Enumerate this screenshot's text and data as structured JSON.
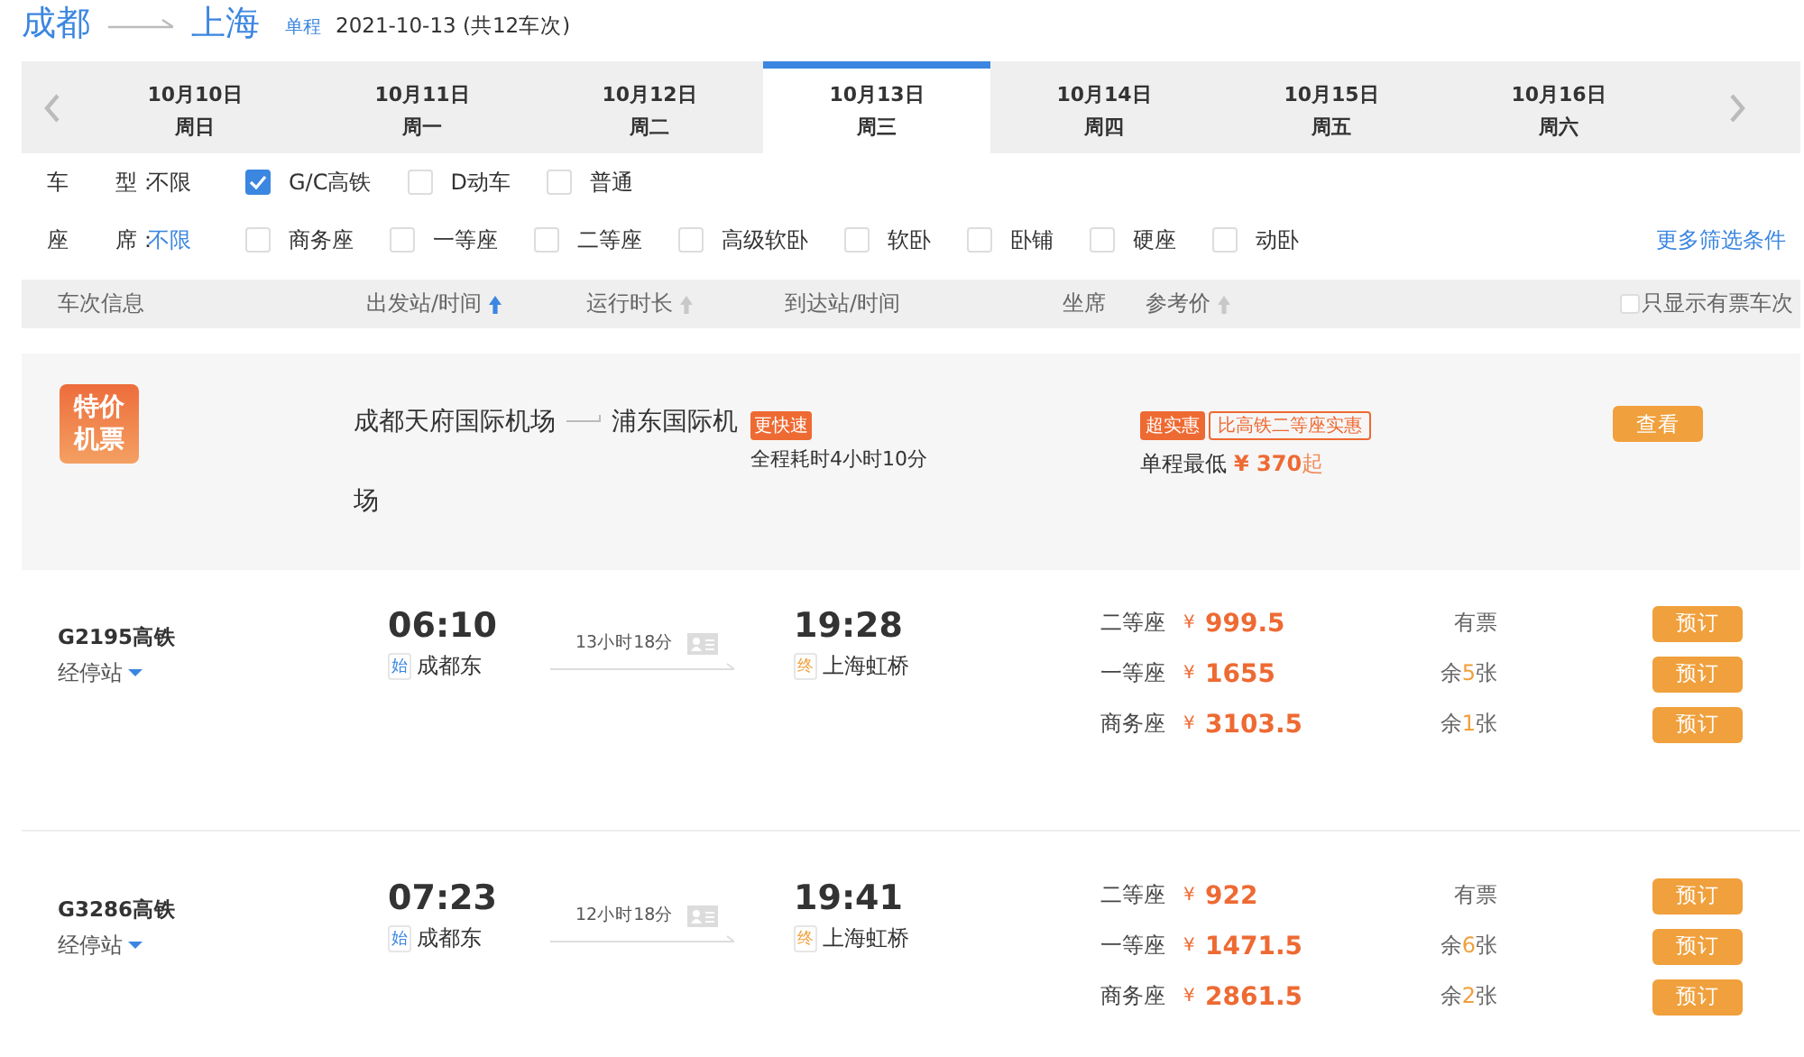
{
  "route": {
    "from": "成都",
    "to": "上海",
    "trip_type": "单程",
    "summary": "2021-10-13 (共12车次)"
  },
  "dates": [
    {
      "date": "10月10日",
      "weekday": "周日",
      "selected": false
    },
    {
      "date": "10月11日",
      "weekday": "周一",
      "selected": false
    },
    {
      "date": "10月12日",
      "weekday": "周二",
      "selected": false
    },
    {
      "date": "10月13日",
      "weekday": "周三",
      "selected": true
    },
    {
      "date": "10月14日",
      "weekday": "周四",
      "selected": false
    },
    {
      "date": "10月15日",
      "weekday": "周五",
      "selected": false
    },
    {
      "date": "10月16日",
      "weekday": "周六",
      "selected": false
    }
  ],
  "filters": [
    {
      "label": "车 型：",
      "any": "不限",
      "any_selected": false,
      "options": [
        {
          "label": "G/C高铁",
          "checked": true
        },
        {
          "label": "D动车",
          "checked": false
        },
        {
          "label": "普通",
          "checked": false
        }
      ]
    },
    {
      "label": "座 席：",
      "any": "不限",
      "any_selected": true,
      "options": [
        {
          "label": "商务座",
          "checked": false
        },
        {
          "label": "一等座",
          "checked": false
        },
        {
          "label": "二等座",
          "checked": false
        },
        {
          "label": "高级软卧",
          "checked": false
        },
        {
          "label": "软卧",
          "checked": false
        },
        {
          "label": "卧铺",
          "checked": false
        },
        {
          "label": "硬座",
          "checked": false
        },
        {
          "label": "动卧",
          "checked": false
        }
      ]
    }
  ],
  "more_filters": "更多筛选条件",
  "columns": [
    {
      "label": "车次信息",
      "kind": "plain"
    },
    {
      "label": "出发站/时间",
      "kind": "sort",
      "sorted": true
    },
    {
      "label": "运行时长",
      "kind": "sort",
      "sorted": false
    },
    {
      "label": "到达站/时间",
      "kind": "plain"
    },
    {
      "label": "坐席",
      "kind": "plain"
    },
    {
      "label": "参考价",
      "kind": "sort",
      "sorted": false
    }
  ],
  "only_available": {
    "label": "只显示有票车次",
    "checked": false
  },
  "promo": {
    "badge": "特价机票",
    "from": "成都天府国际机场",
    "to": "浦东国际机场",
    "speed_tag": "更快速",
    "total_time": "全程耗时4小时10分",
    "deal_tag": "超实惠",
    "compare_tag": "比高铁二等座实惠",
    "min_label": "单程最低",
    "currency": "¥",
    "min_price": "370",
    "price_suffix": "起",
    "button": "查看"
  },
  "trains": [
    {
      "number": "G2195高铁",
      "stops": "经停站",
      "depart_time": "06:10",
      "start_tag": "始",
      "depart_station": "成都东",
      "duration": "13小时18分",
      "arrive_time": "19:28",
      "end_tag": "终",
      "arrive_station": "上海虹桥",
      "seats": [
        {
          "class": "二等座",
          "currency": "¥",
          "price": "999.5",
          "availability": {
            "kind": "plain",
            "text": "有票"
          },
          "button": "预订"
        },
        {
          "class": "一等座",
          "currency": "¥",
          "price": "1655",
          "availability": {
            "kind": "count",
            "prefix": "余",
            "count": "5",
            "suffix": "张"
          },
          "button": "预订"
        },
        {
          "class": "商务座",
          "currency": "¥",
          "price": "3103.5",
          "availability": {
            "kind": "count",
            "prefix": "余",
            "count": "1",
            "suffix": "张"
          },
          "button": "预订"
        }
      ]
    },
    {
      "number": "G3286高铁",
      "stops": "经停站",
      "depart_time": "07:23",
      "start_tag": "始",
      "depart_station": "成都东",
      "duration": "12小时18分",
      "arrive_time": "19:41",
      "end_tag": "终",
      "arrive_station": "上海虹桥",
      "seats": [
        {
          "class": "二等座",
          "currency": "¥",
          "price": "922",
          "availability": {
            "kind": "plain",
            "text": "有票"
          },
          "button": "预订"
        },
        {
          "class": "一等座",
          "currency": "¥",
          "price": "1471.5",
          "availability": {
            "kind": "count",
            "prefix": "余",
            "count": "6",
            "suffix": "张"
          },
          "button": "预订"
        },
        {
          "class": "商务座",
          "currency": "¥",
          "price": "2861.5",
          "availability": {
            "kind": "count",
            "prefix": "余",
            "count": "2",
            "suffix": "张"
          },
          "button": "预订"
        }
      ]
    }
  ]
}
